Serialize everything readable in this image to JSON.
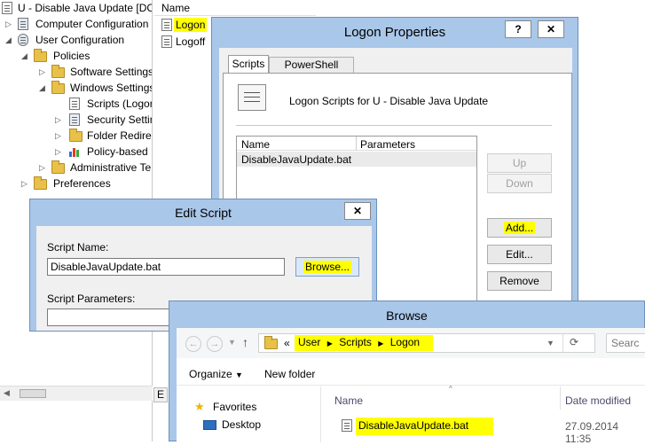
{
  "tree": {
    "root": "U - Disable Java Update [DC",
    "computer_config": "Computer Configuration",
    "user_config": "User Configuration",
    "policies": "Policies",
    "software_settings": "Software Settings",
    "windows_settings": "Windows Settings",
    "scripts": "Scripts (Logon",
    "security_settings": "Security Settin",
    "folder_redirection": "Folder Redire",
    "policy_based": "Policy-based",
    "admin_templates": "Administrative Te",
    "preferences": "Preferences"
  },
  "list": {
    "column_name": "Name",
    "items": [
      "Logon",
      "Logoff"
    ]
  },
  "logon_props": {
    "title": "Logon Properties",
    "help_btn": "?",
    "close_btn": "✕",
    "tabs": [
      "Scripts",
      "PowerShell Scripts"
    ],
    "heading": "Logon Scripts for U - Disable Java Update",
    "col_name": "Name",
    "col_params": "Parameters",
    "row_name": "DisableJavaUpdate.bat",
    "buttons": {
      "up": "Up",
      "down": "Down",
      "add": "Add...",
      "edit": "Edit...",
      "remove": "Remove"
    }
  },
  "edit_script": {
    "title": "Edit Script",
    "close_btn": "✕",
    "name_label": "Script Name:",
    "name_value": "DisableJavaUpdate.bat",
    "browse": "Browse...",
    "params_label": "Script Parameters:"
  },
  "browse": {
    "title": "Browse",
    "breadcrumb_prefix": "«",
    "path": [
      "User",
      "Scripts",
      "Logon"
    ],
    "search_placeholder": "Searc",
    "organize": "Organize",
    "new_folder": "New folder",
    "col_name": "Name",
    "col_date": "Date modified",
    "nav": [
      "Favorites",
      "Desktop"
    ],
    "file_name": "DisableJavaUpdate.bat",
    "file_date": "27.09.2014 11:35"
  },
  "bottom_tab": "E"
}
